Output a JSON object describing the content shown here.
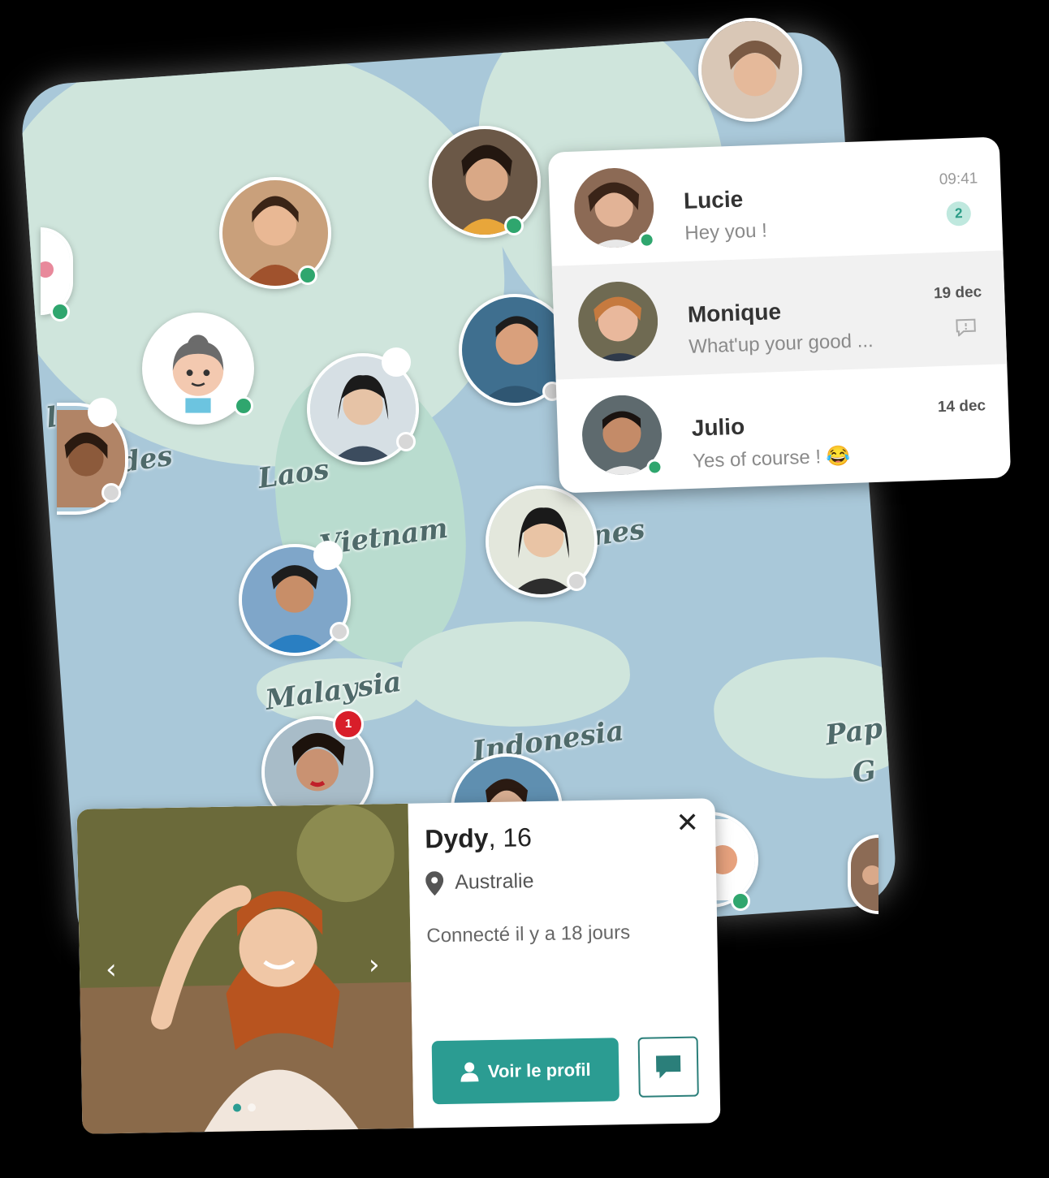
{
  "map": {
    "labels": [
      "Laos",
      "Vietnam",
      "Malaysia",
      "Indonesia",
      "Pap",
      "G",
      "nes",
      "ades",
      "l"
    ],
    "notification_count": "1"
  },
  "chat": {
    "conversations": [
      {
        "name": "Lucie",
        "message": "Hey you !",
        "time": "09:41",
        "unread": "2"
      },
      {
        "name": "Monique",
        "message": "What'up your good ...",
        "time": "19 dec"
      },
      {
        "name": "Julio",
        "message": "Yes of course ! 😂",
        "time": "14 dec"
      }
    ]
  },
  "profile": {
    "name": "Dydy",
    "age": ", 16",
    "location": "Australie",
    "last_seen": "Connecté il y a 18 jours",
    "view_button": "Voir le profil",
    "close_glyph": "✕",
    "prev_glyph": "‹",
    "next_glyph": "›"
  },
  "colors": {
    "accent": "#2b9c92",
    "online": "#2fa66e",
    "badge": "#d81e2a"
  }
}
